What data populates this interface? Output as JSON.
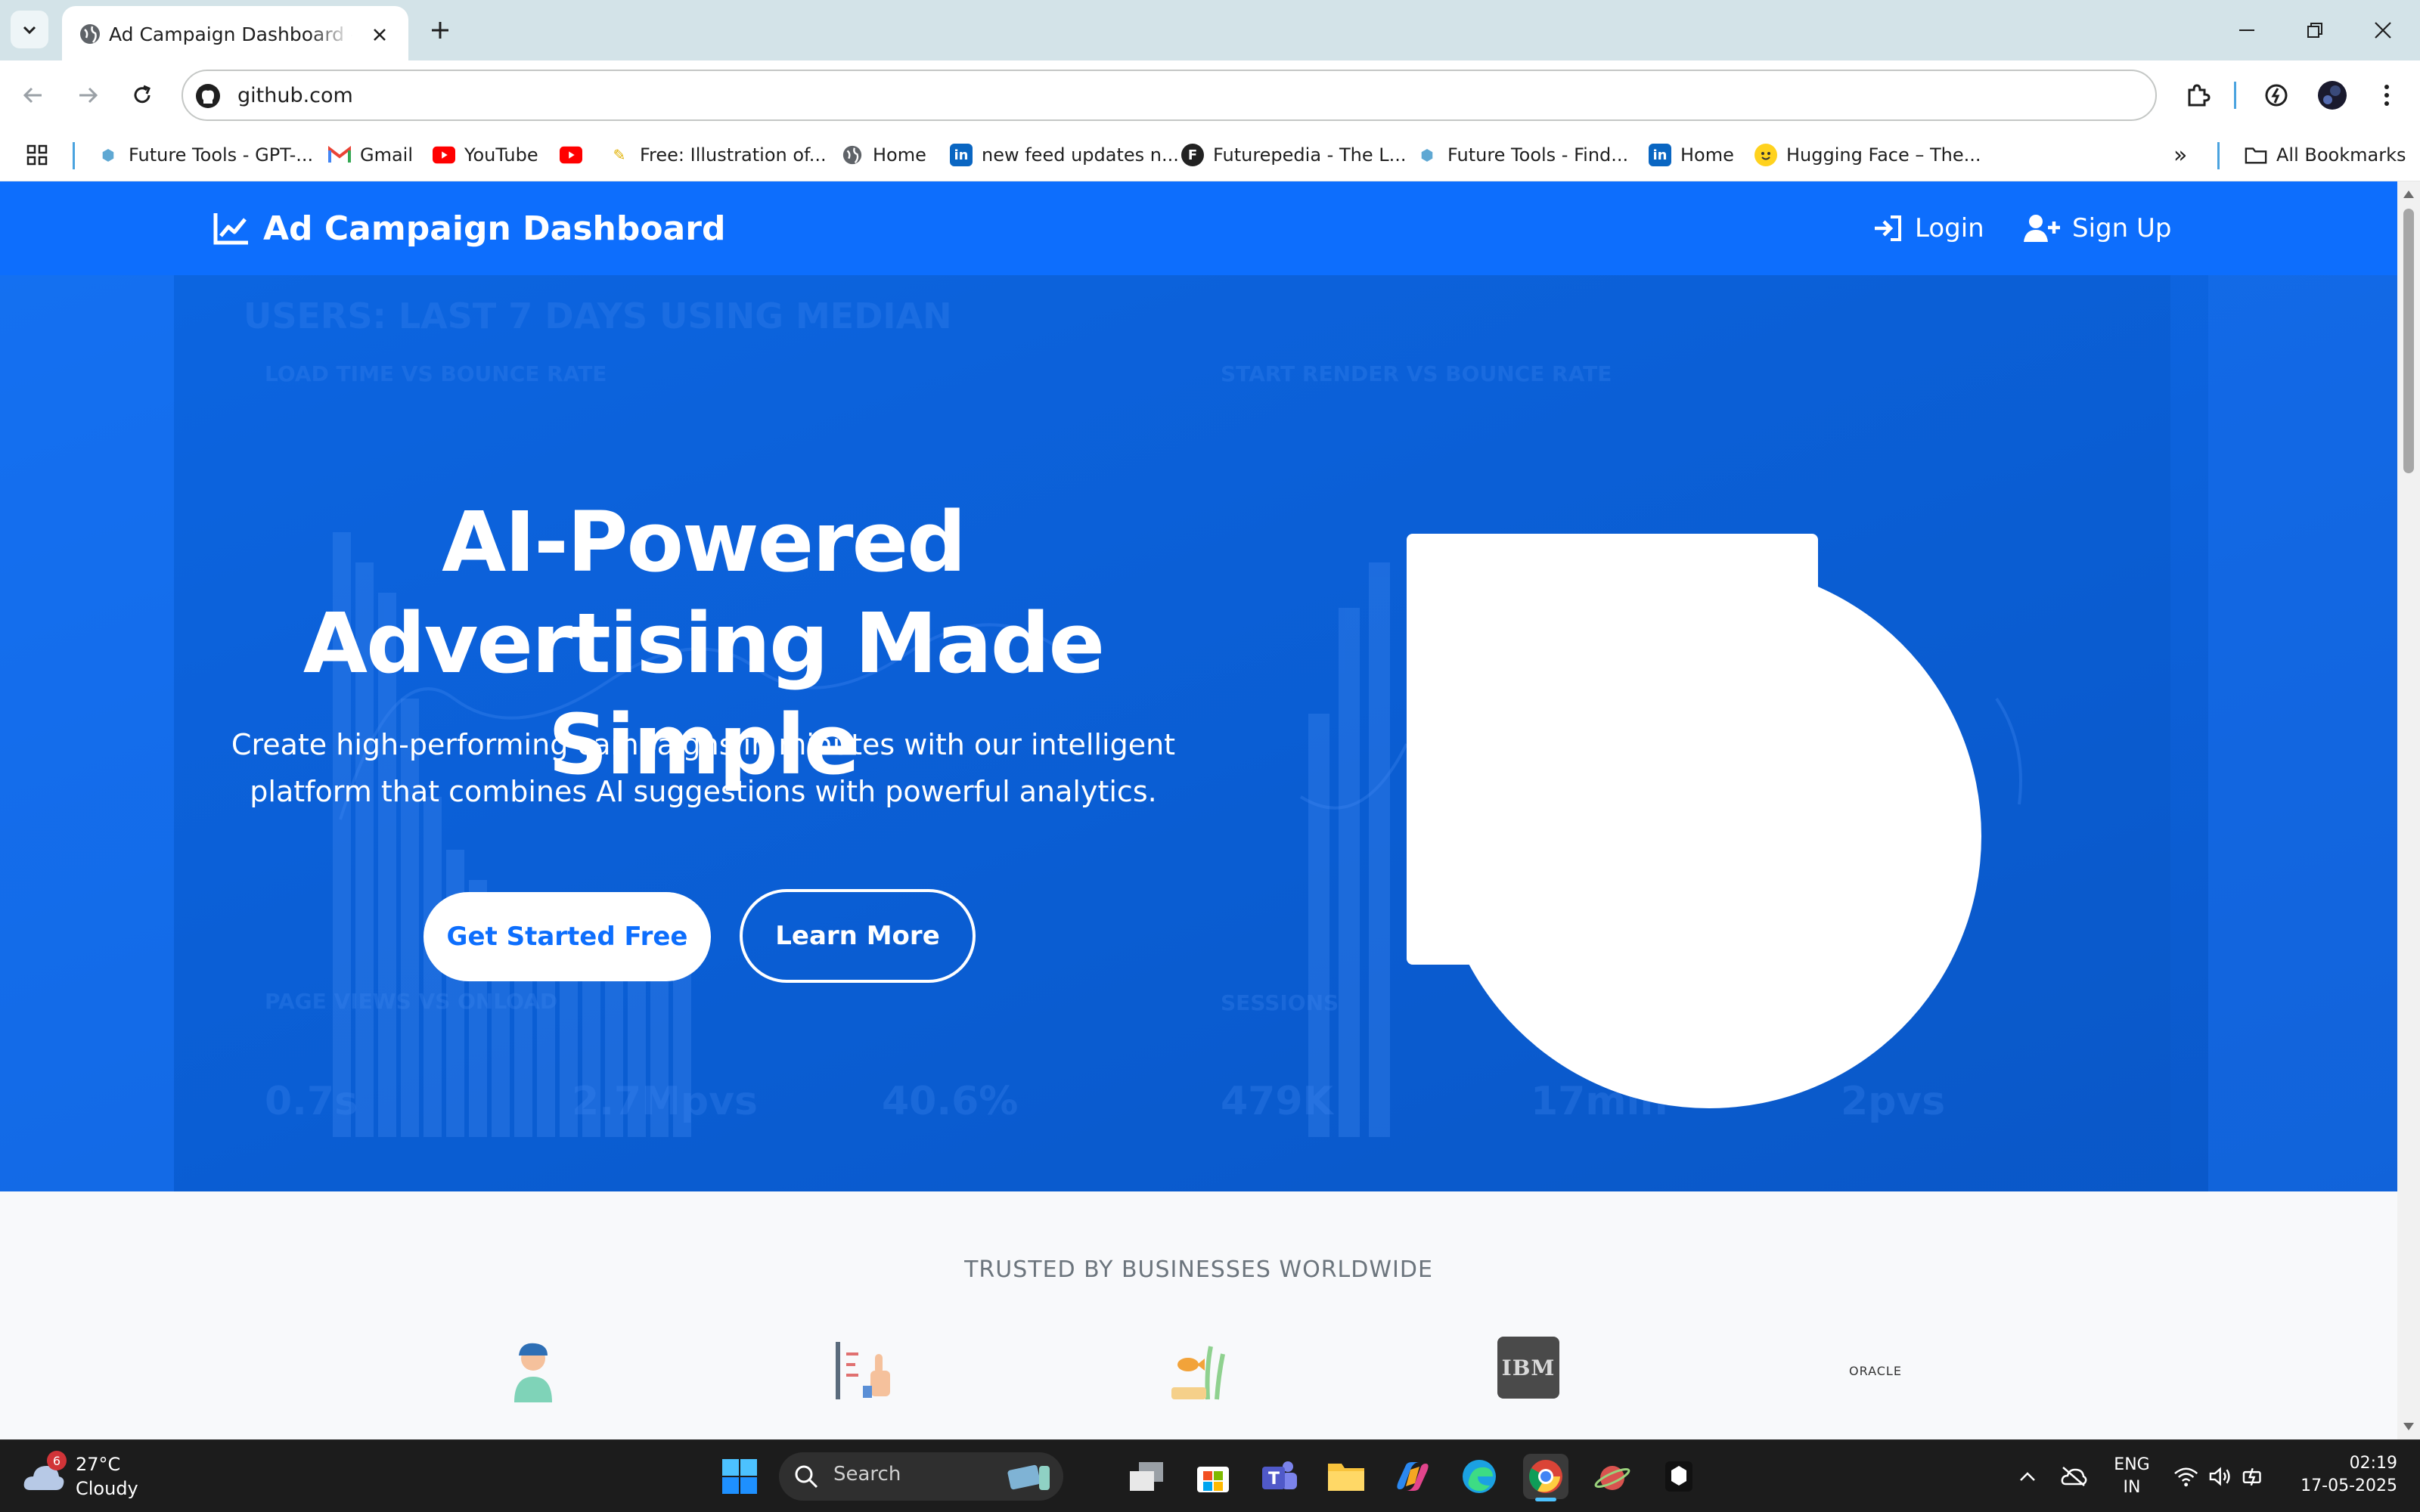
{
  "browser": {
    "tab_title": "Ad Campaign Dashboard - Optimize Your Ads",
    "url": "github.com",
    "bookmarks": [
      {
        "label": "Future Tools - GPT-...",
        "icon": "cube-icon"
      },
      {
        "label": "Gmail",
        "icon": "gmail-icon"
      },
      {
        "label": "YouTube",
        "icon": "youtube-icon"
      },
      {
        "label": "",
        "icon": "youtube-icon"
      },
      {
        "label": "Free: Illustration of...",
        "icon": "illustration-icon"
      },
      {
        "label": "Home",
        "icon": "globe-icon"
      },
      {
        "label": "new feed updates n...",
        "icon": "linkedin-icon"
      },
      {
        "label": "Futurepedia - The L...",
        "icon": "futurepedia-icon"
      },
      {
        "label": "Future Tools - Find...",
        "icon": "cube-icon"
      },
      {
        "label": "Home",
        "icon": "linkedin-icon"
      },
      {
        "label": "Hugging Face – The...",
        "icon": "hugging-face-icon"
      }
    ],
    "all_bookmarks": "All Bookmarks"
  },
  "site": {
    "brand": "Ad Campaign Dashboard",
    "nav": {
      "login": "Login",
      "signup": "Sign Up"
    },
    "hero": {
      "title": "AI-Powered Advertising Made Simple",
      "subtitle": "Create high-performing campaigns in minutes with our intelligent platform that combines AI suggestions with powerful analytics.",
      "cta_primary": "Get Started Free",
      "cta_secondary": "Learn More"
    },
    "trusted": {
      "title": "TRUSTED BY BUSINESSES WORLDWIDE",
      "logos": [
        "person-avatar-logo",
        "chart-hand-logo",
        "fish-aquarium-logo",
        "IBM",
        "ORACLE"
      ]
    }
  },
  "taskbar": {
    "weather": {
      "temp": "27°C",
      "condition": "Cloudy",
      "badge": "6"
    },
    "search_placeholder": "Search",
    "lang": "ENG",
    "region": "IN",
    "time": "02:19",
    "date": "17-05-2025"
  },
  "colors": {
    "brand_blue": "#0d6efd",
    "hero_blue": "#0b5fd6",
    "taskbar": "#1c1c1c"
  }
}
